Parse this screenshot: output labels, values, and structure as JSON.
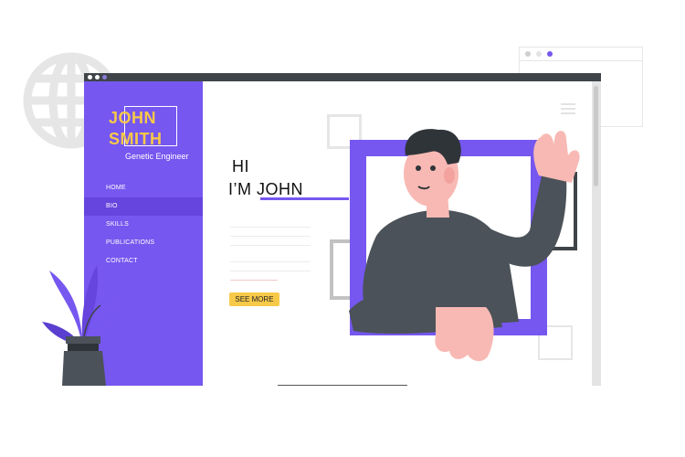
{
  "logo": {
    "first_name": "JOHN",
    "last_name": "SMITH",
    "subtitle": "Genetic Engineer"
  },
  "nav": {
    "items": [
      {
        "label": "HOME",
        "active": false
      },
      {
        "label": "BIO",
        "active": true
      },
      {
        "label": "SKILLS",
        "active": false
      },
      {
        "label": "PUBLICATIONS",
        "active": false
      },
      {
        "label": "CONTACT",
        "active": false
      }
    ]
  },
  "hero": {
    "greeting": "HI",
    "intro": "I’M JOHN",
    "button_label": "SEE MORE"
  },
  "colors": {
    "accent": "#7657ef",
    "button": "#f7c948",
    "logo_text": "#f7c948",
    "titlebar": "#3f4448",
    "shirt": "#4b5259",
    "skin": "#f8b9b4"
  },
  "icons": [
    "globe-icon",
    "hamburger-icon",
    "person-waving-illustration",
    "plant-illustration"
  ]
}
